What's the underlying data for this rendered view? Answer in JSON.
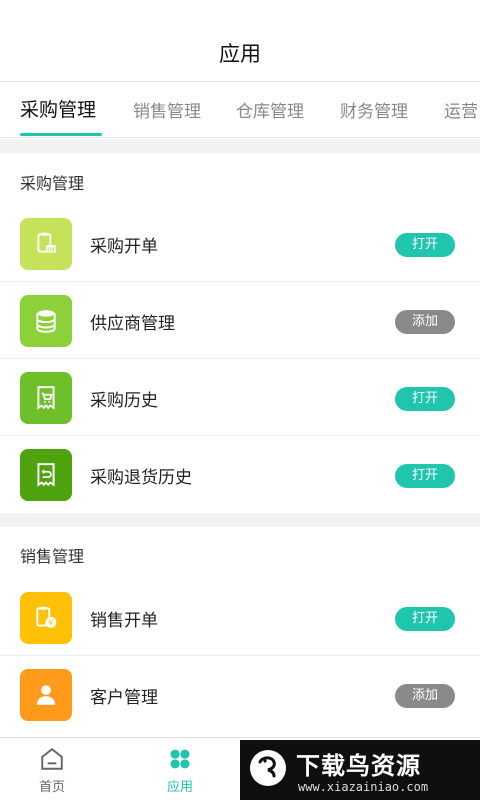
{
  "header": {
    "title": "应用"
  },
  "tabs": [
    {
      "label": "采购管理",
      "active": true
    },
    {
      "label": "销售管理",
      "active": false
    },
    {
      "label": "仓库管理",
      "active": false
    },
    {
      "label": "财务管理",
      "active": false
    },
    {
      "label": "运营",
      "active": false
    }
  ],
  "sections": [
    {
      "title": "采购管理",
      "items": [
        {
          "label": "采购开单",
          "action": "打开",
          "icon": "clipboard-basket-icon",
          "icon_color": "#c5e25a"
        },
        {
          "label": "供应商管理",
          "action": "添加",
          "icon": "database-icon",
          "icon_color": "#8cd03a"
        },
        {
          "label": "采购历史",
          "action": "打开",
          "icon": "cart-receipt-icon",
          "icon_color": "#6fbf2a"
        },
        {
          "label": "采购退货历史",
          "action": "打开",
          "icon": "return-receipt-icon",
          "icon_color": "#4ea30f"
        }
      ]
    },
    {
      "title": "销售管理",
      "items": [
        {
          "label": "销售开单",
          "action": "打开",
          "icon": "clipboard-yen-icon",
          "icon_color": "#ffc107"
        },
        {
          "label": "客户管理",
          "action": "添加",
          "icon": "person-icon",
          "icon_color": "#ff9a1a"
        }
      ]
    }
  ],
  "bottom_nav": [
    {
      "label": "首页",
      "icon": "home-icon",
      "active": false
    },
    {
      "label": "应用",
      "icon": "apps-icon",
      "active": true
    }
  ],
  "watermark": {
    "text": "下载鸟资源",
    "url": "www.xiazainiao.com"
  },
  "colors": {
    "accent": "#20c5ad",
    "add_button": "#8a8a8a",
    "background_gap": "#f2f2f2"
  }
}
